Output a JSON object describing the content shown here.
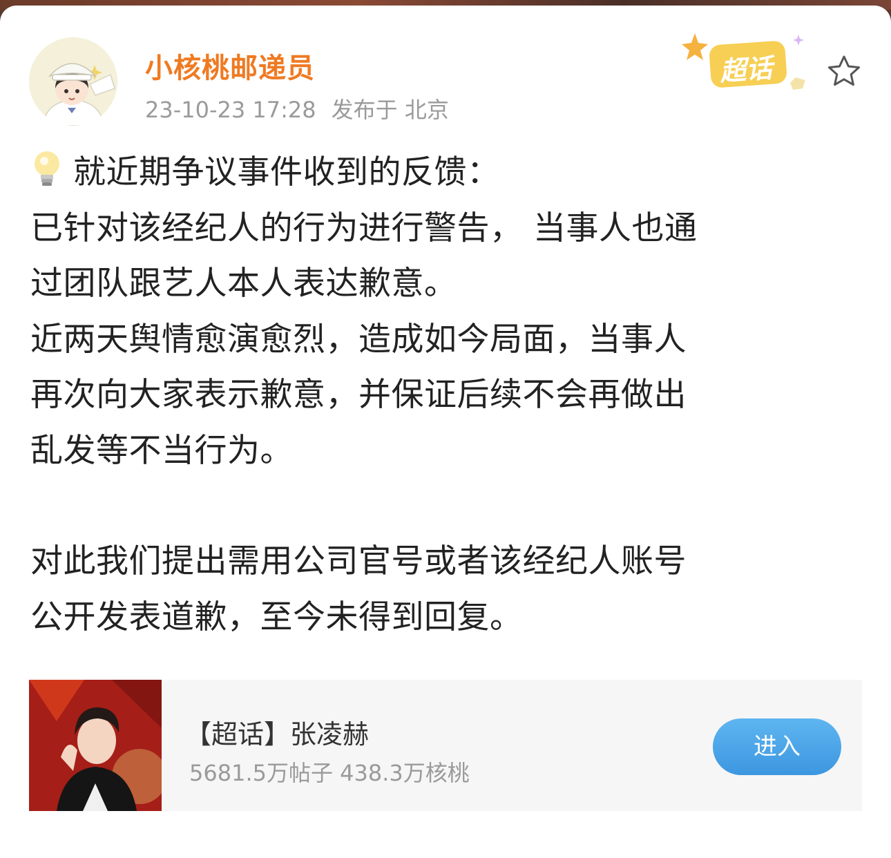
{
  "post": {
    "author": {
      "name": "小核桃邮递员"
    },
    "meta": {
      "time": "23-10-23 17:28",
      "location": "发布于 北京"
    },
    "badge": {
      "label": "超话"
    },
    "paragraphs": [
      "就近期争议事件收到的反馈：",
      "已针对该经纪人的行为进行警告， 当事人也通",
      "过团队跟艺人本人表达歉意。",
      "近两天舆情愈演愈烈，造成如今局面，当事人",
      "再次向大家表示歉意，并保证后续不会再做出",
      "乱发等不当行为。",
      "对此我们提出需用公司官号或者该经纪人账号",
      "公开发表道歉，至今未得到回复。"
    ],
    "icons": {
      "lead": "lightbulb-icon",
      "star": "star-outline-icon"
    }
  },
  "topic_card": {
    "title": "【超话】张凌赫",
    "stats": "5681.5万帖子 438.3万核桃",
    "enter_label": "进入"
  },
  "colors": {
    "author_name": "#ef7a22",
    "meta_text": "#9a9a9a",
    "body_text": "#222222",
    "enter_button": "#4aa3e8",
    "badge": "#f6c94a"
  }
}
